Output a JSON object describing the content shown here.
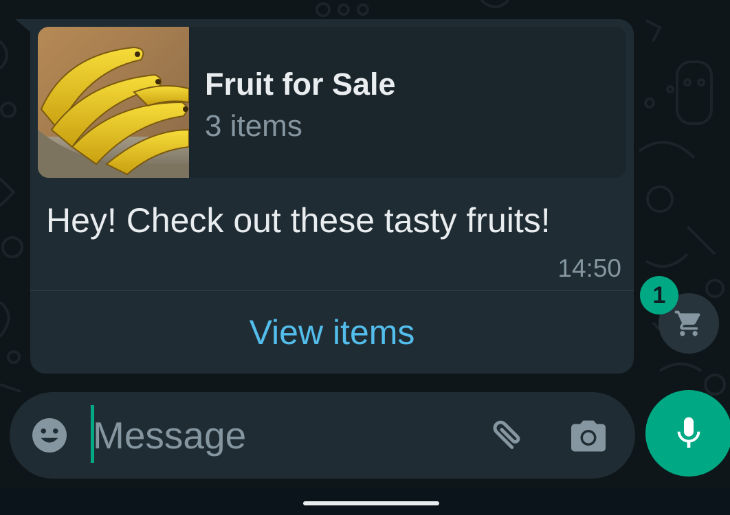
{
  "colors": {
    "bubble": "#1f2c34",
    "accent": "#00a884",
    "link": "#53bdeb",
    "text_primary": "#e9edef",
    "text_secondary": "#8696a0"
  },
  "message": {
    "catalog": {
      "thumbnail_icon": "bananas-photo",
      "title": "Fruit for Sale",
      "item_count": "3 items"
    },
    "text": "Hey! Check out these tasty fruits!",
    "time": "14:50",
    "action_label": "View items"
  },
  "cart": {
    "icon": "cart-icon",
    "badge_count": "1"
  },
  "composer": {
    "placeholder": "Message",
    "value": "",
    "emoji_icon": "emoji-icon",
    "attach_icon": "paperclip-icon",
    "camera_icon": "camera-icon"
  },
  "mic": {
    "icon": "mic-icon"
  }
}
